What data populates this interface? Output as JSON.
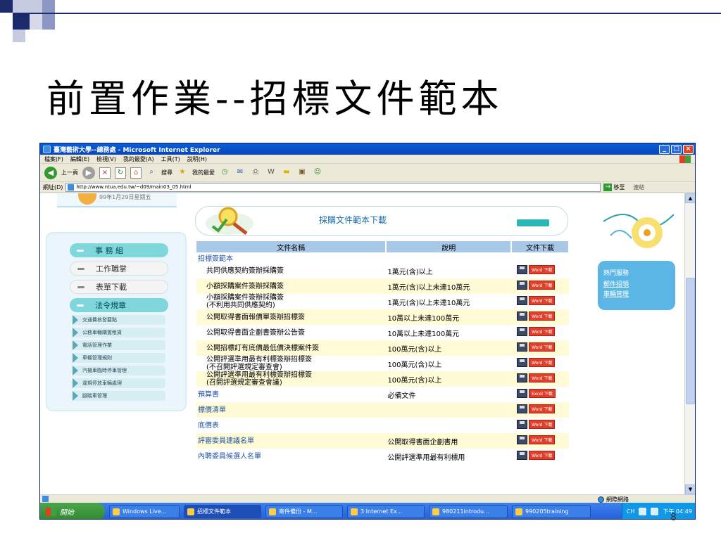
{
  "slide": {
    "title": "前置作業--招標文件範本",
    "page_number": "8"
  },
  "browser": {
    "window_title": "臺灣藝術大學--總務處 - Microsoft Internet Explorer",
    "menu": [
      "檔案(F)",
      "編輯(E)",
      "檢視(V)",
      "我的最愛(A)",
      "工具(T)",
      "說明(H)"
    ],
    "toolbar": {
      "back_label": "上一頁",
      "search_label": "搜尋",
      "favorites_label": "我的最愛"
    },
    "address_label": "網址(D)",
    "address_value": "http://www.ntua.edu.tw/~d09/main03_05.html",
    "go_label": "移至",
    "links_label": "連結",
    "status_zone": "網際網路"
  },
  "page": {
    "date_text": "99年1月29日星期五",
    "banner_title": "採購文件範本下載",
    "nav_main": [
      {
        "label": "事 務 組",
        "style": "teal"
      },
      {
        "label": "工作職掌",
        "style": "gray"
      },
      {
        "label": "表單下載",
        "style": "gray"
      },
      {
        "label": "法令規章",
        "style": "teal"
      }
    ],
    "nav_sub": [
      "交通費核發要點",
      "公務車輛購置租賃",
      "電話管理作業",
      "車輛管理規則",
      "汽機車臨時停車管理",
      "違規停放車輛處理",
      "腳踏車管理"
    ],
    "table": {
      "headers": [
        "文件名稱",
        "說明",
        "文件下載"
      ],
      "category": "招標簽範本",
      "rows": [
        {
          "name": "共同供應契約簽辦採購簽",
          "desc": "1萬元(含)以上",
          "dl": "Word 下載",
          "highlight": false,
          "indent": true
        },
        {
          "name": "小額採購案件簽辦採購簽",
          "desc": "1萬元(含)以上未達10萬元",
          "dl": "Word 下載",
          "highlight": true,
          "indent": true
        },
        {
          "name": "小額採購案件簽辦採購簽\n(不利用共同供應契約)",
          "desc": "1萬元(含)以上未達10萬元",
          "dl": "Word 下載",
          "highlight": false,
          "indent": true
        },
        {
          "name": "公開取得書面報價單簽辦招標簽",
          "desc": "10萬以上未達100萬元",
          "dl": "Word 下載",
          "highlight": true,
          "indent": true
        },
        {
          "name": "公開取得書面企劃書簽辦公告簽",
          "desc": "10萬以上未達100萬元",
          "dl": "Word 下載",
          "highlight": false,
          "indent": true
        },
        {
          "name": "公開招標訂有底價最低價決標案件簽",
          "desc": "100萬元(含)以上",
          "dl": "Word 下載",
          "highlight": true,
          "indent": true
        },
        {
          "name": "公開評選準用最有利標簽辦招標簽\n(不召開評選規定審查會)",
          "desc": "100萬元(含)以上",
          "dl": "Word 下載",
          "highlight": false,
          "indent": true
        },
        {
          "name": "公開評選準用最有利標簽辦招標簽\n(召開評選規定審查會議)",
          "desc": "100萬元(含)以上",
          "dl": "Word 下載",
          "highlight": true,
          "indent": true
        },
        {
          "name": "預算書",
          "desc": "必備文件",
          "dl": "Excel 下載",
          "highlight": false,
          "indent": false
        },
        {
          "name": "標價清單",
          "desc": "",
          "dl": "Word 下載",
          "highlight": true,
          "indent": false
        },
        {
          "name": "底價表",
          "desc": "",
          "dl": "Word 下載",
          "highlight": false,
          "indent": false
        },
        {
          "name": "評審委員建議名單",
          "desc": "公開取得書面企劃書用",
          "dl": "Word 下載",
          "highlight": true,
          "indent": false
        },
        {
          "name": "內聘委員候選人名單",
          "desc": "公開評選準用最有利標用",
          "dl": "Word 下載",
          "highlight": false,
          "indent": false
        }
      ]
    },
    "hot_services": {
      "title": "熱門服務",
      "links": [
        "郵件招領",
        "車輛管理"
      ]
    }
  },
  "taskbar": {
    "start_label": "開始",
    "tasks": [
      "Windows Live...",
      "招標文件範本",
      "寄件備份 - M...",
      "3 Internet Ex...",
      "980211introdu...",
      "990205training"
    ],
    "lang": "CH",
    "clock": "下午 04:49"
  }
}
